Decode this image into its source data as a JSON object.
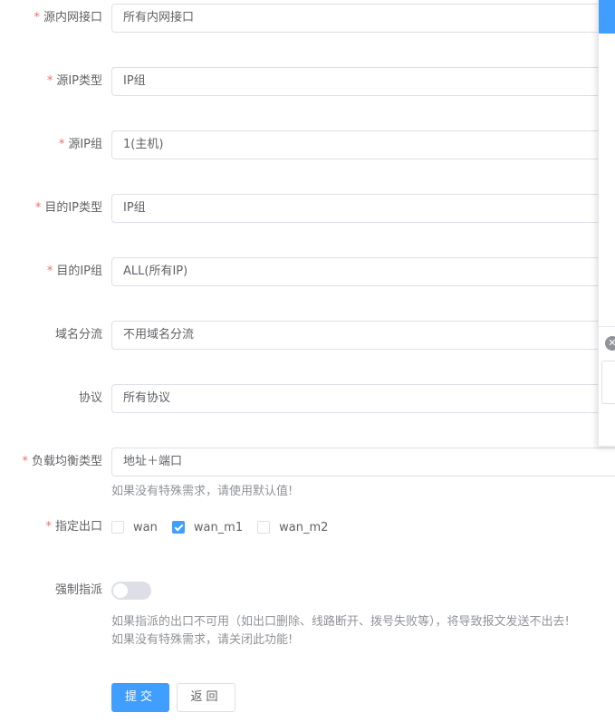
{
  "form": {
    "fields": [
      {
        "label": "源内网接口",
        "required": true,
        "value": "所有内网接口"
      },
      {
        "label": "源IP类型",
        "required": true,
        "value": "IP组"
      },
      {
        "label": "源IP组",
        "required": true,
        "value": "1(主机)"
      },
      {
        "label": "目的IP类型",
        "required": true,
        "value": "IP组"
      },
      {
        "label": "目的IP组",
        "required": true,
        "value": "ALL(所有IP)"
      },
      {
        "label": "域名分流",
        "required": false,
        "value": "不用域名分流"
      },
      {
        "label": "协议",
        "required": false,
        "value": "所有协议"
      },
      {
        "label": "负载均衡类型",
        "required": true,
        "value": "地址＋端口"
      }
    ],
    "lb_hint": "如果没有特殊需求，请使用默认值!",
    "exit": {
      "label": "指定出口",
      "required": true,
      "options": [
        {
          "label": "wan",
          "checked": false
        },
        {
          "label": "wan_m1",
          "checked": true
        },
        {
          "label": "wan_m2",
          "checked": false
        }
      ]
    },
    "force": {
      "label": "强制指派",
      "enabled": false,
      "hint_1": "如果指派的出口不可用（如出口删除、线路断开、拨号失败等），将导致报文发送不出去!",
      "hint_2": "如果没有特殊需求，请关闭此功能!"
    },
    "submit_label": "提交",
    "back_label": "返回"
  },
  "panel": {
    "close_glyph": "✕"
  },
  "colors": {
    "primary": "#409eff",
    "required": "#f56c6c",
    "hint": "#909399"
  }
}
